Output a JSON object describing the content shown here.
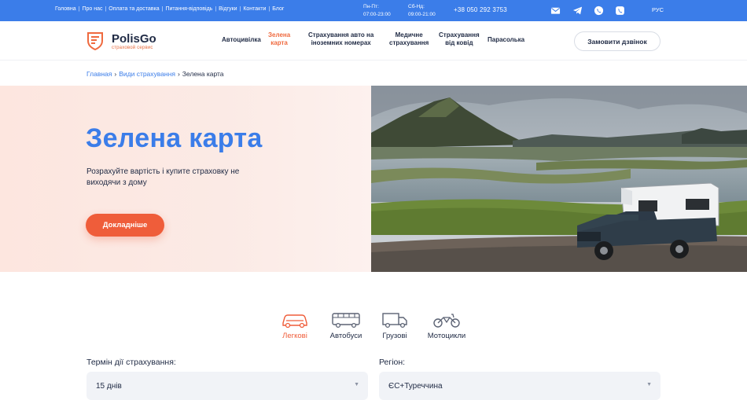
{
  "topbar": {
    "nav": [
      "Головна",
      "Про нас",
      "Оплата та доставка",
      "Питання-відповідь",
      "Відгуки",
      "Контакти",
      "Блог"
    ],
    "hours_weekday_label": "Пн-Пт:",
    "hours_weekday_value": "07:00-23:00",
    "hours_weekend_label": "Сб-Нд:",
    "hours_weekend_value": "09:00-21:00",
    "phone": "+38 050 292 3753",
    "language": "РУС"
  },
  "header": {
    "logo_name": "PolisGo",
    "logo_tagline": "страховой сервис",
    "nav": [
      {
        "line1": "Автоцивілка",
        "line2": ""
      },
      {
        "line1": "Зелена",
        "line2": "карта"
      },
      {
        "line1": "Страхування авто на",
        "line2": "іноземних номерах"
      },
      {
        "line1": "Медичне",
        "line2": "страхування"
      },
      {
        "line1": "Страхування",
        "line2": "від ковід"
      },
      {
        "line1": "Парасолька",
        "line2": ""
      }
    ],
    "cta": "Замовити дзвінок"
  },
  "breadcrumb": {
    "home": "Главная",
    "section": "Види страхування",
    "current": "Зелена карта",
    "separator": "›"
  },
  "hero": {
    "title": "Зелена карта",
    "text": "Розрахуйте вартість і купите страховку не виходячи з дому",
    "button": "Докладніше"
  },
  "vehicle_tabs": [
    {
      "label": "Легкові",
      "icon": "car-icon"
    },
    {
      "label": "Автобуси",
      "icon": "bus-icon"
    },
    {
      "label": "Грузові",
      "icon": "truck-icon"
    },
    {
      "label": "Мотоцикли",
      "icon": "motorcycle-icon"
    }
  ],
  "form": {
    "term_label": "Термін дії страхування:",
    "term_value": "15 днів",
    "region_label": "Регіон:",
    "region_value": "ЄС+Туреччина"
  },
  "colors": {
    "brand_blue": "#3b7de9",
    "accent_orange": "#ef5d3a"
  }
}
